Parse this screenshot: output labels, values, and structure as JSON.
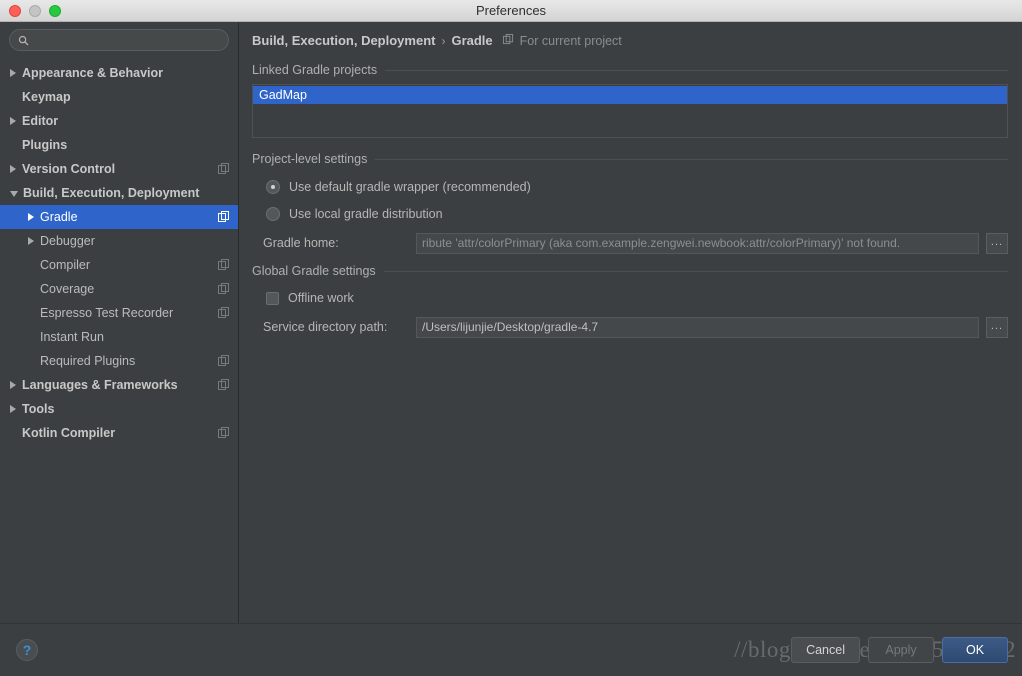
{
  "window": {
    "title": "Preferences",
    "traffic_lights": [
      "close",
      "minimize",
      "maximize"
    ]
  },
  "search": {
    "value": "",
    "placeholder": "",
    "icon": "search-icon"
  },
  "sidebar": {
    "items": [
      {
        "label": "Appearance & Behavior",
        "arrow": "right",
        "bold": true,
        "indent": 0,
        "selected": false,
        "has_project_icon": false
      },
      {
        "label": "Keymap",
        "arrow": "none",
        "bold": true,
        "indent": 0,
        "selected": false,
        "has_project_icon": false
      },
      {
        "label": "Editor",
        "arrow": "right",
        "bold": true,
        "indent": 0,
        "selected": false,
        "has_project_icon": false
      },
      {
        "label": "Plugins",
        "arrow": "none",
        "bold": true,
        "indent": 0,
        "selected": false,
        "has_project_icon": false
      },
      {
        "label": "Version Control",
        "arrow": "right",
        "bold": true,
        "indent": 0,
        "selected": false,
        "has_project_icon": true
      },
      {
        "label": "Build, Execution, Deployment",
        "arrow": "down",
        "bold": true,
        "indent": 0,
        "selected": false,
        "has_project_icon": false
      },
      {
        "label": "Gradle",
        "arrow": "right",
        "bold": false,
        "indent": 1,
        "selected": true,
        "has_project_icon": true
      },
      {
        "label": "Debugger",
        "arrow": "right",
        "bold": false,
        "indent": 1,
        "selected": false,
        "has_project_icon": false
      },
      {
        "label": "Compiler",
        "arrow": "none",
        "bold": false,
        "indent": 1,
        "selected": false,
        "has_project_icon": true
      },
      {
        "label": "Coverage",
        "arrow": "none",
        "bold": false,
        "indent": 1,
        "selected": false,
        "has_project_icon": true
      },
      {
        "label": "Espresso Test Recorder",
        "arrow": "none",
        "bold": false,
        "indent": 1,
        "selected": false,
        "has_project_icon": true
      },
      {
        "label": "Instant Run",
        "arrow": "none",
        "bold": false,
        "indent": 1,
        "selected": false,
        "has_project_icon": false
      },
      {
        "label": "Required Plugins",
        "arrow": "none",
        "bold": false,
        "indent": 1,
        "selected": false,
        "has_project_icon": true
      },
      {
        "label": "Languages & Frameworks",
        "arrow": "right",
        "bold": true,
        "indent": 0,
        "selected": false,
        "has_project_icon": true
      },
      {
        "label": "Tools",
        "arrow": "right",
        "bold": true,
        "indent": 0,
        "selected": false,
        "has_project_icon": false
      },
      {
        "label": "Kotlin Compiler",
        "arrow": "none",
        "bold": true,
        "indent": 0,
        "selected": false,
        "has_project_icon": true
      }
    ]
  },
  "breadcrumb": {
    "parent": "Build, Execution, Deployment",
    "separator": "›",
    "current": "Gradle",
    "scope_icon": "project-scope-icon",
    "scope": "For current project"
  },
  "main": {
    "linked_projects": {
      "section_title": "Linked Gradle projects",
      "items": [
        {
          "label": "GadMap",
          "selected": true
        }
      ]
    },
    "project_level_settings": {
      "section_title": "Project-level settings",
      "radios": [
        {
          "label": "Use default gradle wrapper (recommended)",
          "checked": true
        },
        {
          "label": "Use local gradle distribution",
          "checked": false
        }
      ],
      "gradle_home": {
        "label": "Gradle home:",
        "value": "ribute 'attr/colorPrimary (aka com.example.zengwei.newbook:attr/colorPrimary)' not found.",
        "placeholder": "",
        "browse_label": "..."
      }
    },
    "global_gradle_settings": {
      "section_title": "Global Gradle settings",
      "offline_work": {
        "label": "Offline work",
        "checked": false
      },
      "service_directory_path": {
        "label": "Service directory path:",
        "value": "/Users/lijunjie/Desktop/gradle-4.7",
        "placeholder": "",
        "browse_label": "..."
      }
    }
  },
  "footer": {
    "help_label": "?",
    "cancel_label": "Cancel",
    "apply_label": "Apply",
    "ok_label": "OK",
    "apply_enabled": false,
    "watermark": "//blog.csdn.net/qq_35608482"
  },
  "colors": {
    "window_bg": "#3c3f41",
    "sidebar_bg": "#3c3f41",
    "selection_blue": "#2f65ca",
    "accent_blue": "#3592d5",
    "default_button_blue": "#3b5a86",
    "text": "#bbbbbb",
    "muted_text": "#8a8d8f",
    "titlebar_bg": "#e8e8e8"
  }
}
